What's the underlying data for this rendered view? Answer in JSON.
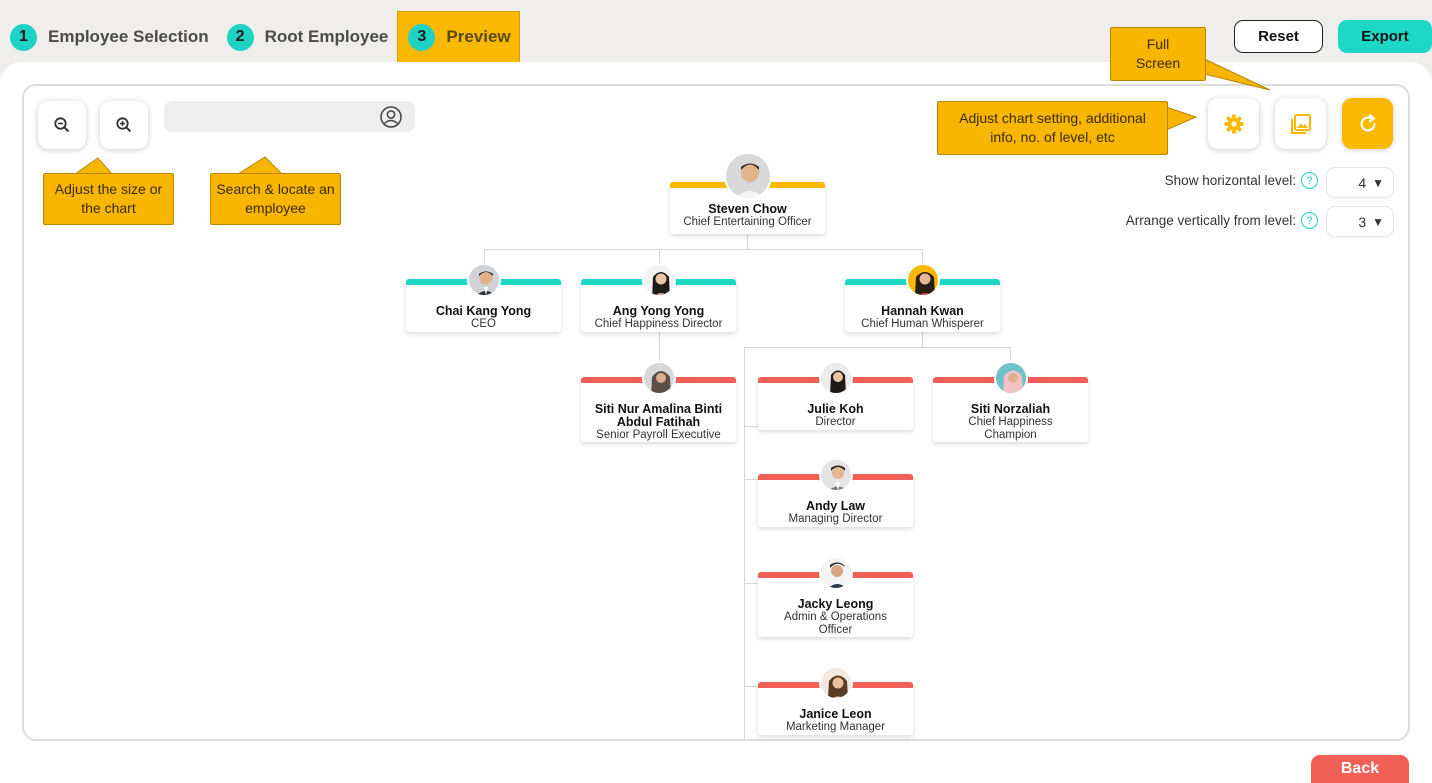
{
  "steps": [
    {
      "num": "1",
      "label": "Employee Selection"
    },
    {
      "num": "2",
      "label": "Root Employee"
    },
    {
      "num": "3",
      "label": "Preview"
    }
  ],
  "actions": {
    "reset": "Reset",
    "export": "Export",
    "back": "Back"
  },
  "toolbar": {
    "zoom_out_icon": "zoom-out-icon",
    "zoom_in_icon": "zoom-in-icon",
    "search_placeholder": "",
    "search_icon": "person-search-icon",
    "settings_icon": "gear-icon",
    "fullscreen_icon": "image-frame-icon",
    "refresh_icon": "refresh-icon"
  },
  "callouts": {
    "zoom": "Adjust the size or the chart",
    "search": "Search & locate an employee",
    "settings": "Adjust chart setting, additional info, no. of level, etc",
    "fullscreen": "Full Screen"
  },
  "settings": {
    "horizontal_label": "Show horizontal level:",
    "horizontal_value": "4",
    "vertical_label": "Arrange vertically from level:",
    "vertical_value": "3",
    "help_icon": "?",
    "caret": "▼"
  },
  "colors": {
    "level1": "#fbb800",
    "level2": "#1ed8c6",
    "level3": "#f16056"
  },
  "employees": [
    {
      "name": "Steven Chow",
      "title": "Chief Entertaining Officer"
    },
    {
      "name": "Chai Kang Yong",
      "title": "CEO"
    },
    {
      "name": "Ang Yong Yong",
      "title": "Chief Happiness Director"
    },
    {
      "name": "Hannah Kwan",
      "title": "Chief Human Whisperer"
    },
    {
      "name": "Siti Nur Amalina Binti Abdul Fatihah",
      "title": "Senior Payroll Executive"
    },
    {
      "name": "Julie Koh",
      "title": "Director"
    },
    {
      "name": "Siti Norzaliah",
      "title": "Chief Happiness Champion"
    },
    {
      "name": "Andy Law",
      "title": "Managing Director"
    },
    {
      "name": "Jacky Leong",
      "title": "Admin & Operations Officer"
    },
    {
      "name": "Janice Leon",
      "title": "Marketing Manager"
    }
  ]
}
